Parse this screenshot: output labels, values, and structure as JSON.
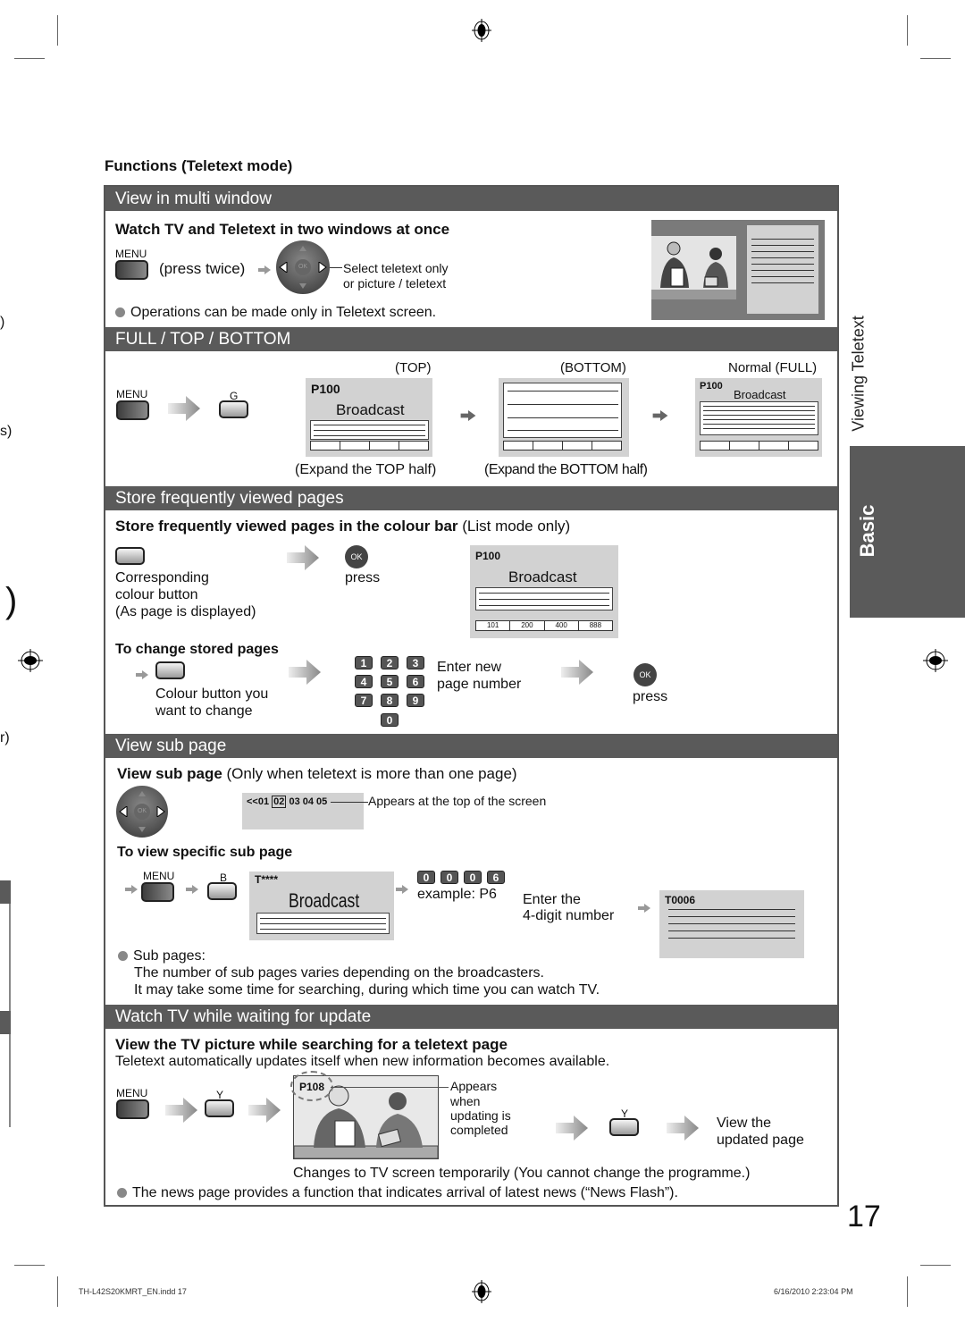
{
  "page": {
    "section_heading": "Functions (Teletext mode)",
    "side_label": "Viewing Teletext",
    "side_tab": "Basic",
    "page_number": "17",
    "footer_left": "TH-L42S20KMRT_EN.indd   17",
    "footer_right": "6/16/2010   2:23:04 PM",
    "left_edge_fragments": [
      ")",
      "s)",
      ")",
      "r)"
    ]
  },
  "multi_window": {
    "title": "View in multi window",
    "subtitle": "Watch TV and Teletext in two windows at once",
    "menu_label": "MENU",
    "press_twice": "(press twice)",
    "dpad_ok": "OK",
    "callout_line1": "Select teletext only",
    "callout_line2": "or picture / teletext",
    "note": "Operations can be made only in Teletext screen."
  },
  "full_top_bottom": {
    "title": "FULL / TOP / BOTTOM",
    "menu_label": "MENU",
    "g_label": "G",
    "top_label": "(TOP)",
    "bottom_label": "(BOTTOM)",
    "full_label": "Normal (FULL)",
    "page_code": "P100",
    "broadcast": "Broadcast",
    "top_caption": "(Expand the TOP half)",
    "bottom_caption": "(Expand the BOTTOM half)"
  },
  "store_pages": {
    "title": "Store frequently viewed pages",
    "subtitle_bold": "Store frequently viewed pages in the colour bar",
    "subtitle_rest": " (List mode only)",
    "colour_line1": "Corresponding",
    "colour_line2": "colour button",
    "colour_line3": "(As page is displayed)",
    "ok_label": "OK",
    "press": "press",
    "page_code": "P100",
    "broadcast": "Broadcast",
    "colour_bar_pages": [
      "101",
      "200",
      "400",
      "888"
    ],
    "change_heading": "To change stored pages",
    "change_line1": "Colour button you",
    "change_line2": "want to change",
    "keypad": [
      "1",
      "2",
      "3",
      "4",
      "5",
      "6",
      "7",
      "8",
      "9",
      "0"
    ],
    "enter_line1": "Enter new",
    "enter_line2": "page number",
    "press2": "press"
  },
  "sub_page": {
    "title": "View sub page",
    "subtitle_bold": "View sub page",
    "subtitle_rest": " (Only when teletext is more than one page)",
    "dpad_ok": "OK",
    "subpage_prefix": "<<01",
    "subpage_current": "02",
    "subpage_rest": "03 04 05",
    "callout": "Appears at the top of the screen",
    "specific_heading": "To view specific sub page",
    "menu_label": "MENU",
    "b_label": "B",
    "screen_code": "T****",
    "broadcast": "Broadcast",
    "digits": [
      "0",
      "0",
      "0",
      "6"
    ],
    "example": "example: P6",
    "enter_line1": "Enter the",
    "enter_line2": "4-digit number",
    "result_code": "T0006",
    "note_title": "Sub pages:",
    "note_line1": "The number of sub pages varies depending on the broadcasters.",
    "note_line2": "It may take some time for searching, during which time you can watch TV."
  },
  "update": {
    "title": "Watch TV while waiting for update",
    "subtitle": "View the TV picture while searching for a teletext page",
    "desc": "Teletext automatically updates itself when new information becomes available.",
    "menu_label": "MENU",
    "y_label": "Y",
    "page_code": "P108",
    "appears_line1": "Appears",
    "appears_line2": "when",
    "appears_line3": "updating is",
    "appears_line4": "completed",
    "y_label2": "Y",
    "view_line1": "View the",
    "view_line2": "updated page",
    "changes_note": "Changes to TV screen temporarily (You cannot change the programme.)",
    "news_note": "The news page provides a function that indicates arrival of latest news (“News Flash”)."
  }
}
